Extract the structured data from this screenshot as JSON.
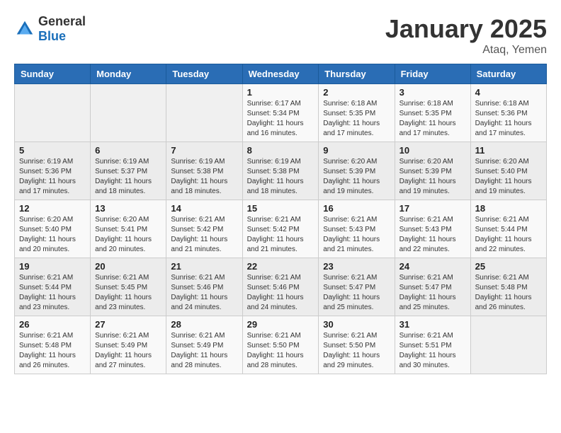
{
  "header": {
    "logo_general": "General",
    "logo_blue": "Blue",
    "month_title": "January 2025",
    "location": "Ataq, Yemen"
  },
  "days_of_week": [
    "Sunday",
    "Monday",
    "Tuesday",
    "Wednesday",
    "Thursday",
    "Friday",
    "Saturday"
  ],
  "weeks": [
    [
      {
        "day": "",
        "sunrise": "",
        "sunset": "",
        "daylight": ""
      },
      {
        "day": "",
        "sunrise": "",
        "sunset": "",
        "daylight": ""
      },
      {
        "day": "",
        "sunrise": "",
        "sunset": "",
        "daylight": ""
      },
      {
        "day": "1",
        "sunrise": "Sunrise: 6:17 AM",
        "sunset": "Sunset: 5:34 PM",
        "daylight": "Daylight: 11 hours and 16 minutes."
      },
      {
        "day": "2",
        "sunrise": "Sunrise: 6:18 AM",
        "sunset": "Sunset: 5:35 PM",
        "daylight": "Daylight: 11 hours and 17 minutes."
      },
      {
        "day": "3",
        "sunrise": "Sunrise: 6:18 AM",
        "sunset": "Sunset: 5:35 PM",
        "daylight": "Daylight: 11 hours and 17 minutes."
      },
      {
        "day": "4",
        "sunrise": "Sunrise: 6:18 AM",
        "sunset": "Sunset: 5:36 PM",
        "daylight": "Daylight: 11 hours and 17 minutes."
      }
    ],
    [
      {
        "day": "5",
        "sunrise": "Sunrise: 6:19 AM",
        "sunset": "Sunset: 5:36 PM",
        "daylight": "Daylight: 11 hours and 17 minutes."
      },
      {
        "day": "6",
        "sunrise": "Sunrise: 6:19 AM",
        "sunset": "Sunset: 5:37 PM",
        "daylight": "Daylight: 11 hours and 18 minutes."
      },
      {
        "day": "7",
        "sunrise": "Sunrise: 6:19 AM",
        "sunset": "Sunset: 5:38 PM",
        "daylight": "Daylight: 11 hours and 18 minutes."
      },
      {
        "day": "8",
        "sunrise": "Sunrise: 6:19 AM",
        "sunset": "Sunset: 5:38 PM",
        "daylight": "Daylight: 11 hours and 18 minutes."
      },
      {
        "day": "9",
        "sunrise": "Sunrise: 6:20 AM",
        "sunset": "Sunset: 5:39 PM",
        "daylight": "Daylight: 11 hours and 19 minutes."
      },
      {
        "day": "10",
        "sunrise": "Sunrise: 6:20 AM",
        "sunset": "Sunset: 5:39 PM",
        "daylight": "Daylight: 11 hours and 19 minutes."
      },
      {
        "day": "11",
        "sunrise": "Sunrise: 6:20 AM",
        "sunset": "Sunset: 5:40 PM",
        "daylight": "Daylight: 11 hours and 19 minutes."
      }
    ],
    [
      {
        "day": "12",
        "sunrise": "Sunrise: 6:20 AM",
        "sunset": "Sunset: 5:40 PM",
        "daylight": "Daylight: 11 hours and 20 minutes."
      },
      {
        "day": "13",
        "sunrise": "Sunrise: 6:20 AM",
        "sunset": "Sunset: 5:41 PM",
        "daylight": "Daylight: 11 hours and 20 minutes."
      },
      {
        "day": "14",
        "sunrise": "Sunrise: 6:21 AM",
        "sunset": "Sunset: 5:42 PM",
        "daylight": "Daylight: 11 hours and 21 minutes."
      },
      {
        "day": "15",
        "sunrise": "Sunrise: 6:21 AM",
        "sunset": "Sunset: 5:42 PM",
        "daylight": "Daylight: 11 hours and 21 minutes."
      },
      {
        "day": "16",
        "sunrise": "Sunrise: 6:21 AM",
        "sunset": "Sunset: 5:43 PM",
        "daylight": "Daylight: 11 hours and 21 minutes."
      },
      {
        "day": "17",
        "sunrise": "Sunrise: 6:21 AM",
        "sunset": "Sunset: 5:43 PM",
        "daylight": "Daylight: 11 hours and 22 minutes."
      },
      {
        "day": "18",
        "sunrise": "Sunrise: 6:21 AM",
        "sunset": "Sunset: 5:44 PM",
        "daylight": "Daylight: 11 hours and 22 minutes."
      }
    ],
    [
      {
        "day": "19",
        "sunrise": "Sunrise: 6:21 AM",
        "sunset": "Sunset: 5:44 PM",
        "daylight": "Daylight: 11 hours and 23 minutes."
      },
      {
        "day": "20",
        "sunrise": "Sunrise: 6:21 AM",
        "sunset": "Sunset: 5:45 PM",
        "daylight": "Daylight: 11 hours and 23 minutes."
      },
      {
        "day": "21",
        "sunrise": "Sunrise: 6:21 AM",
        "sunset": "Sunset: 5:46 PM",
        "daylight": "Daylight: 11 hours and 24 minutes."
      },
      {
        "day": "22",
        "sunrise": "Sunrise: 6:21 AM",
        "sunset": "Sunset: 5:46 PM",
        "daylight": "Daylight: 11 hours and 24 minutes."
      },
      {
        "day": "23",
        "sunrise": "Sunrise: 6:21 AM",
        "sunset": "Sunset: 5:47 PM",
        "daylight": "Daylight: 11 hours and 25 minutes."
      },
      {
        "day": "24",
        "sunrise": "Sunrise: 6:21 AM",
        "sunset": "Sunset: 5:47 PM",
        "daylight": "Daylight: 11 hours and 25 minutes."
      },
      {
        "day": "25",
        "sunrise": "Sunrise: 6:21 AM",
        "sunset": "Sunset: 5:48 PM",
        "daylight": "Daylight: 11 hours and 26 minutes."
      }
    ],
    [
      {
        "day": "26",
        "sunrise": "Sunrise: 6:21 AM",
        "sunset": "Sunset: 5:48 PM",
        "daylight": "Daylight: 11 hours and 26 minutes."
      },
      {
        "day": "27",
        "sunrise": "Sunrise: 6:21 AM",
        "sunset": "Sunset: 5:49 PM",
        "daylight": "Daylight: 11 hours and 27 minutes."
      },
      {
        "day": "28",
        "sunrise": "Sunrise: 6:21 AM",
        "sunset": "Sunset: 5:49 PM",
        "daylight": "Daylight: 11 hours and 28 minutes."
      },
      {
        "day": "29",
        "sunrise": "Sunrise: 6:21 AM",
        "sunset": "Sunset: 5:50 PM",
        "daylight": "Daylight: 11 hours and 28 minutes."
      },
      {
        "day": "30",
        "sunrise": "Sunrise: 6:21 AM",
        "sunset": "Sunset: 5:50 PM",
        "daylight": "Daylight: 11 hours and 29 minutes."
      },
      {
        "day": "31",
        "sunrise": "Sunrise: 6:21 AM",
        "sunset": "Sunset: 5:51 PM",
        "daylight": "Daylight: 11 hours and 30 minutes."
      },
      {
        "day": "",
        "sunrise": "",
        "sunset": "",
        "daylight": ""
      }
    ]
  ]
}
